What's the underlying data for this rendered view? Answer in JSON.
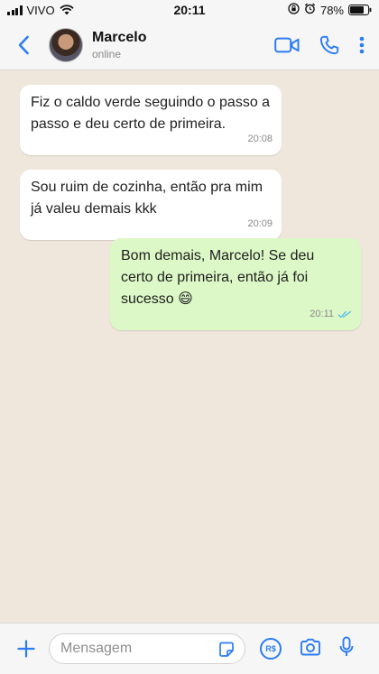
{
  "status_bar": {
    "carrier": "VIVO",
    "time": "20:11",
    "battery_percent": "78%",
    "battery_level": 0.78
  },
  "header": {
    "contact_name": "Marcelo",
    "contact_status": "online"
  },
  "messages": [
    {
      "direction": "incoming",
      "text": "Fiz o caldo verde seguindo o passo a passo e deu certo de primeira.",
      "time": "20:08"
    },
    {
      "direction": "incoming",
      "text": "Sou ruim de cozinha, então pra mim já valeu demais kkk",
      "time": "20:09"
    },
    {
      "direction": "outgoing",
      "text": "Bom demais, Marcelo! Se deu certo de primeira, então já foi sucesso 😄",
      "time": "20:11",
      "read": true
    }
  ],
  "composer": {
    "placeholder": "Mensagem",
    "value": "",
    "payment_label": "R$"
  },
  "colors": {
    "accent": "#2b7cf6",
    "outgoing_bubble": "#dcf8c6",
    "incoming_bubble": "#ffffff",
    "chat_background": "#efe7dc",
    "read_ticks": "#53bdeb"
  }
}
